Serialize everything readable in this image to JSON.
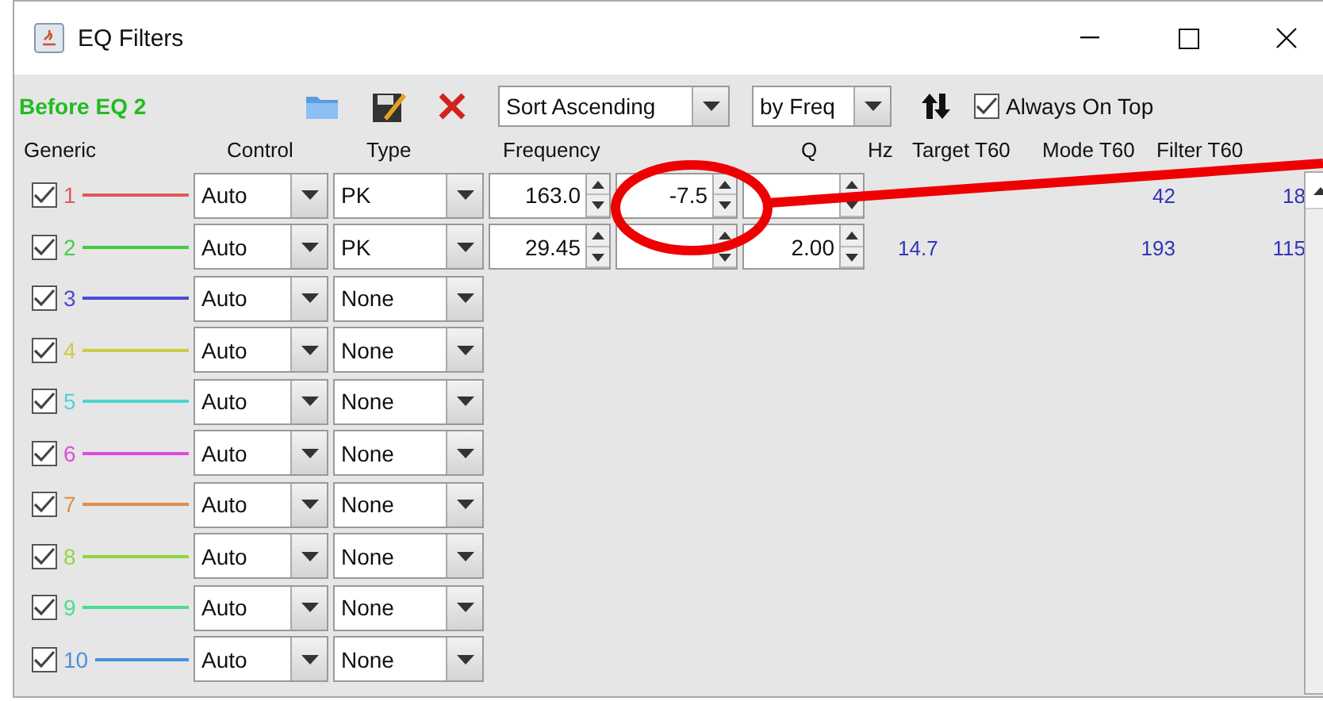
{
  "window": {
    "title": "EQ Filters"
  },
  "toolbar": {
    "label": "Before EQ 2",
    "sort_order": "Sort Ascending",
    "sort_key": "by Freq",
    "always_on_top": {
      "label": "Always On Top",
      "checked": true
    }
  },
  "columns": [
    "Generic",
    "Control",
    "Type",
    "Frequency",
    "Q",
    "Hz",
    "Target T60",
    "Mode T60",
    "Filter T60"
  ],
  "rows": [
    {
      "number": "1",
      "color": "#e05a5a",
      "checked": true,
      "control": "Auto",
      "type": "PK",
      "frequency": "163.0",
      "gain": "-7.5",
      "mode_t60": "42",
      "filter_t60": "18"
    },
    {
      "number": "2",
      "color": "#44cc44",
      "checked": true,
      "control": "Auto",
      "type": "PK",
      "frequency": "29.45",
      "q": "2.00",
      "hz": "14.7",
      "mode_t60": "193",
      "filter_t60": "115"
    },
    {
      "number": "3",
      "color": "#4a4ad6",
      "checked": true,
      "control": "Auto",
      "type": "None"
    },
    {
      "number": "4",
      "color": "#cccc44",
      "checked": true,
      "control": "Auto",
      "type": "None"
    },
    {
      "number": "5",
      "color": "#4cd4d4",
      "checked": true,
      "control": "Auto",
      "type": "None"
    },
    {
      "number": "6",
      "color": "#dd4cdd",
      "checked": true,
      "control": "Auto",
      "type": "None"
    },
    {
      "number": "7",
      "color": "#dd8f4c",
      "checked": true,
      "control": "Auto",
      "type": "None"
    },
    {
      "number": "8",
      "color": "#8ed640",
      "checked": true,
      "control": "Auto",
      "type": "None"
    },
    {
      "number": "9",
      "color": "#4cdc8c",
      "checked": true,
      "control": "Auto",
      "type": "None"
    },
    {
      "number": "10",
      "color": "#4c8fdc",
      "checked": true,
      "control": "Auto",
      "type": "None"
    }
  ]
}
